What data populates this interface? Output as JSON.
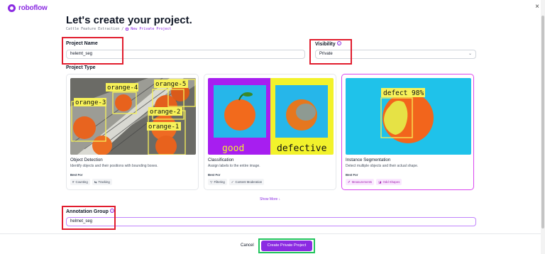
{
  "brand": {
    "name": "roboflow",
    "color": "#8b2be2"
  },
  "window": {
    "close_label": "×"
  },
  "page": {
    "title": "Let's create your project.",
    "breadcrumb": {
      "workspace": "Cattle Feature Extraction",
      "separator": "/",
      "project": "New Private Project"
    }
  },
  "form": {
    "project_name": {
      "label": "Project Name",
      "value": "helemt_seg"
    },
    "visibility": {
      "label": "Visibility",
      "help": "?",
      "value": "Private"
    },
    "project_type": {
      "label": "Project Type"
    },
    "annotation_group": {
      "label": "Annotation Group",
      "help": "?",
      "value": "helmet_seg"
    }
  },
  "cards": [
    {
      "title": "Object Detection",
      "description": "Identify objects and their positions with bounding boxes.",
      "best_for": "Best For",
      "tags": [
        {
          "icon": "#",
          "label": "Counting"
        },
        {
          "icon": "⇆",
          "label": "Tracking"
        }
      ],
      "image_labels": [
        "orange-4",
        "orange-5",
        "orange-3",
        "orange-2",
        "orange-1"
      ],
      "selected": false
    },
    {
      "title": "Classification",
      "description": "Assign labels to the entire image.",
      "best_for": "Best For",
      "tags": [
        {
          "icon": "▽",
          "label": "Filtering"
        },
        {
          "icon": "✓",
          "label": "Content Moderation"
        }
      ],
      "image_labels": [
        "good",
        "defective"
      ],
      "selected": false
    },
    {
      "title": "Instance Segmentation",
      "description": "Detect multiple objects and their actual shape.",
      "best_for": "Best For",
      "tags": [
        {
          "icon": "✐",
          "label": "Measurements"
        },
        {
          "icon": "◪",
          "label": "Odd Shapes"
        }
      ],
      "image_labels": [
        "defect 98%"
      ],
      "selected": true
    }
  ],
  "show_more": "Show More ↓",
  "footer": {
    "cancel": "Cancel",
    "create": "Create Private Project"
  },
  "colors": {
    "accent": "#8b2be2",
    "highlight_red": "#e11d2e",
    "highlight_green": "#22c55e",
    "label_yellow": "#f7f25a"
  }
}
